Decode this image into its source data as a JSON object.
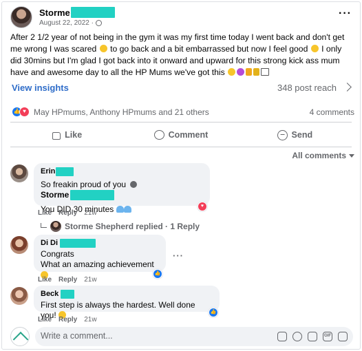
{
  "post": {
    "author_first": "Storme",
    "date": "August 22, 2022 ·",
    "more": "···",
    "text_1": "After 2 1/2 year of not being in the gym it was my first time today I went back and don't get me wrong I was scared",
    "text_2": "to go back and a bit embarrassed but now I feel good",
    "text_3": "I only did 30mins but I'm glad I got back into it onward and upward for this strong kick ass mum have and awesome day to all the HP Mums we've got this",
    "view_insights": "View insights",
    "post_reach": "348 post reach",
    "reaction_names": "May HPmums, Anthony HPmums and 21 others",
    "comment_count": "4 comments"
  },
  "actions": {
    "like": "Like",
    "comment": "Comment",
    "send": "Send"
  },
  "sort": {
    "label": "All comments"
  },
  "comments": [
    {
      "name": "Erin",
      "text_1": "So freakin proud of you",
      "mention": "Storme",
      "text_2": "You DID 30 minutes",
      "like": "Like",
      "reply": "Reply",
      "time": "21w",
      "replied_text": "Storme Shepherd replied · 1 Reply"
    },
    {
      "name": "Di Di",
      "text_1": "Congrats",
      "text_2": "What an amazing achievement",
      "like": "Like",
      "reply": "Reply",
      "time": "21w",
      "more": "···"
    },
    {
      "name": "Beck",
      "text_1": "First step is always the hardest. Well done you!",
      "like": "Like",
      "reply": "Reply",
      "time": "21w"
    }
  ],
  "write_comment": {
    "placeholder": "Write a comment..."
  },
  "icons": {
    "tools": [
      "sticker-icon",
      "emoji-icon",
      "camera-icon",
      "gif-icon",
      "sticker-square-icon"
    ],
    "tool_gif_label": "GIF"
  },
  "colors": {
    "link_blue": "#2f6dc9",
    "redaction": "#22d1c3",
    "like_blue": "#1877f2",
    "love_red": "#f33e58",
    "bubble_gray": "#f0f2f5"
  }
}
